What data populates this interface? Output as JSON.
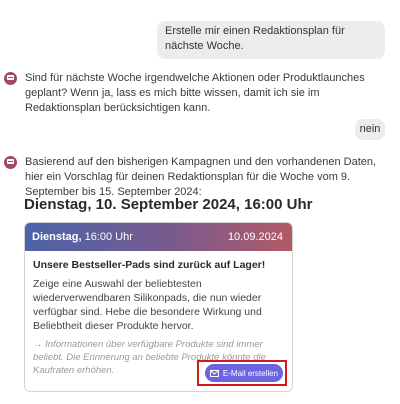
{
  "messages": {
    "user_1": "Erstelle mir einen Redaktionsplan für nächste Woche.",
    "assistant_1": "Sind für nächste Woche irgendwelche Aktionen oder Produktlaunches geplant? Wenn ja, lass es mich bitte wissen, damit ich sie im Redaktionsplan berücksichtigen kann.",
    "user_2": "nein",
    "assistant_2": "Basierend auf den bisherigen Kampagnen und den vorhandenen Daten, hier ein Vorschlag für deinen Redaktionsplan für die Woche vom 9. September bis 15. September 2024:"
  },
  "plan": {
    "day_heading": "Dienstag, 10. September 2024, 16:00 Uhr",
    "card": {
      "day": "Dienstag,",
      "time": " 16:00 Uhr",
      "date": "10.09.2024",
      "title": "Unsere Bestseller-Pads sind zurück auf Lager!",
      "description": "Zeige eine Auswahl der beliebtesten wiederverwendbaren Silikonpads, die nun wieder verfügbar sind. Hebe die besondere Wirkung und Beliebtheit dieser Produkte hervor.",
      "note": "→ Informationen über verfügbare Produkte sind immer beliebt. Die Erinnerung an beliebte Produkte könnte die Kaufraten erhöhen.",
      "button_label": "E-Mail erstellen"
    }
  },
  "colors": {
    "assistant_icon": "#a04a62",
    "button": "#6b63e0",
    "highlight": "#d11a1a"
  },
  "icons": {
    "assistant": "chat-bubble-icon",
    "button": "mail-icon"
  }
}
